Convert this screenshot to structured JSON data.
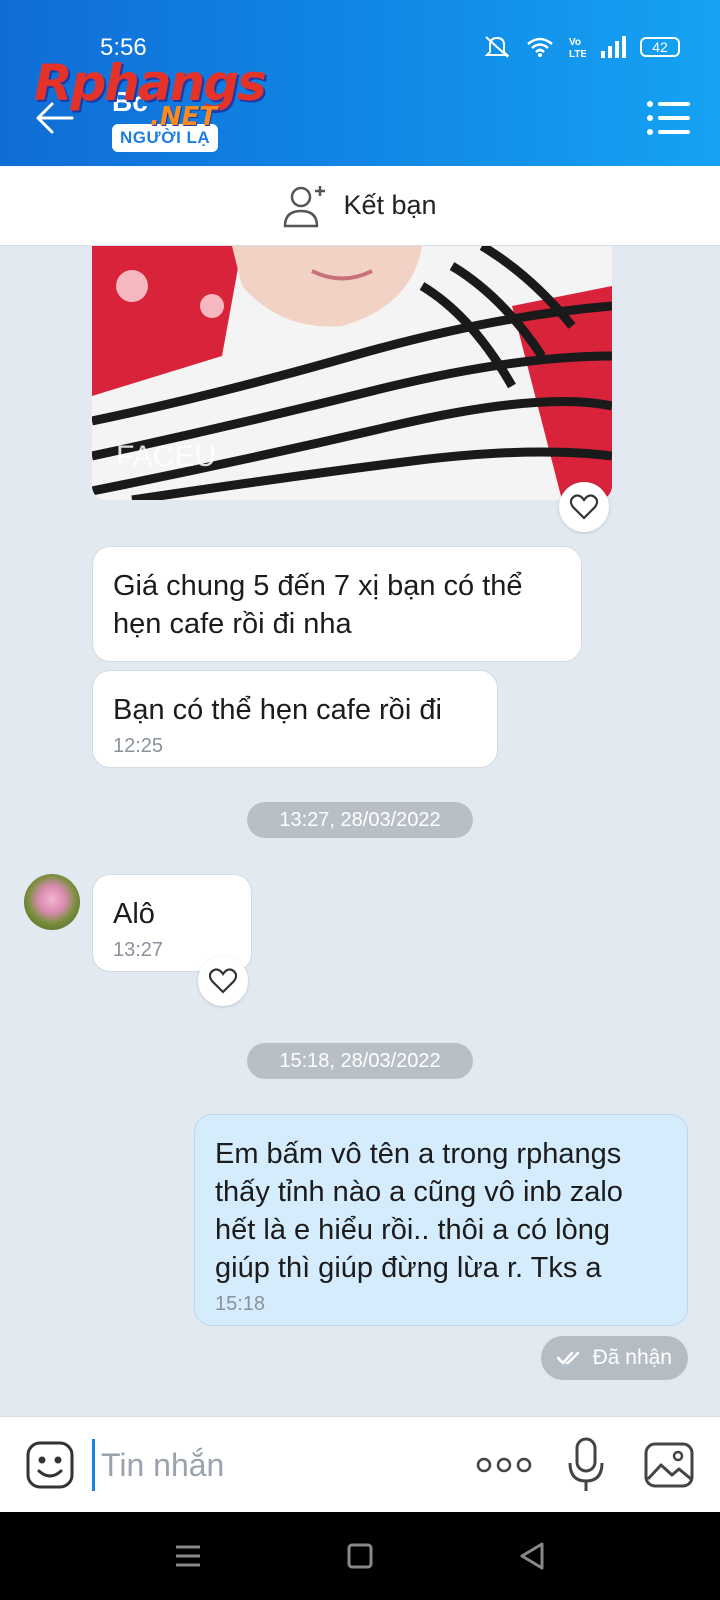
{
  "status_bar": {
    "time": "5:56",
    "battery": "42"
  },
  "header": {
    "contact_name": "Bc",
    "stranger_badge": "NGƯỜI LẠ",
    "watermark": "Rphangs",
    "watermark_net": ".NET"
  },
  "friend_bar": {
    "label": "Kết bạn"
  },
  "messages": [
    {
      "text": "Giá chung 5 đến 7 xị bạn có thể hẹn cafe rồi đi nha",
      "time": ""
    },
    {
      "text": "Bạn có thể hẹn cafe rồi đi",
      "time": "12:25"
    },
    {
      "date": "13:27, 28/03/2022"
    },
    {
      "text": "Alô",
      "time": "13:27"
    },
    {
      "date": "15:18, 28/03/2022"
    },
    {
      "text": "Em bấm vô tên a trong rphangs thấy tỉnh nào a cũng vô inb zalo hết là e hiểu rồi.. thôi a có lòng giúp thì giúp đừng lừa r. Tks a",
      "time": "15:18"
    }
  ],
  "photo_caption": "FACEU",
  "receipt": "Đã nhận",
  "input": {
    "placeholder": "Tin nhắn"
  },
  "icons": {
    "back": "back-arrow-icon",
    "menu": "list-menu-icon",
    "add_friend": "add-friend-icon",
    "heart": "heart-icon",
    "emoji": "emoji-icon",
    "more": "more-dots-icon",
    "mic": "microphone-icon",
    "image": "image-icon"
  },
  "colors": {
    "header_start": "#0f6dd6",
    "header_end": "#15a3f3",
    "my_bubble": "#d5ecfd",
    "accent": "#1f7fe0"
  }
}
